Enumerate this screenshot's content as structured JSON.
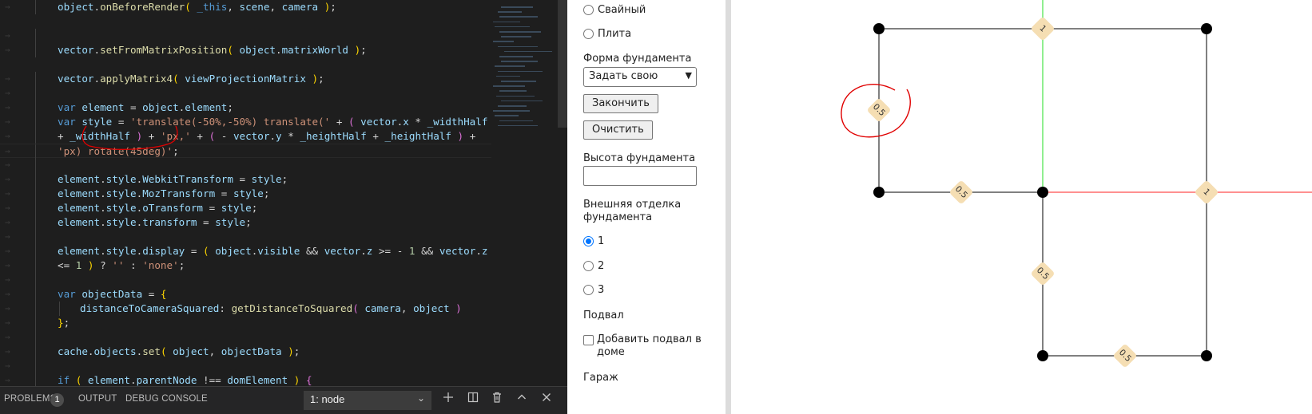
{
  "editor": {
    "lines": [
      {
        "indent": 1,
        "tokens": [
          [
            "v",
            "object"
          ],
          [
            "p",
            "."
          ],
          [
            "f",
            "onBeforeRender"
          ],
          [
            "b",
            "( "
          ],
          [
            "k",
            "_this"
          ],
          [
            "p",
            ", "
          ],
          [
            "v",
            "scene"
          ],
          [
            "p",
            ", "
          ],
          [
            "v",
            "camera"
          ],
          [
            "b",
            " )"
          ],
          [
            "p",
            ";"
          ]
        ]
      },
      {
        "indent": 1,
        "tokens": []
      },
      {
        "indent": 1,
        "tokens": [
          [
            "v",
            "vector"
          ],
          [
            "p",
            "."
          ],
          [
            "f",
            "setFromMatrixPosition"
          ],
          [
            "b",
            "( "
          ],
          [
            "v",
            "object"
          ],
          [
            "p",
            "."
          ],
          [
            "v",
            "matrixWorld"
          ],
          [
            "b",
            " )"
          ],
          [
            "p",
            ";"
          ]
        ]
      },
      {
        "indent": 1,
        "tokens": [
          [
            "v",
            "vector"
          ],
          [
            "p",
            "."
          ],
          [
            "f",
            "applyMatrix4"
          ],
          [
            "b",
            "( "
          ],
          [
            "v",
            "viewProjectionMatrix"
          ],
          [
            "b",
            " )"
          ],
          [
            "p",
            ";"
          ]
        ]
      },
      {
        "indent": 1,
        "tokens": []
      },
      {
        "indent": 1,
        "tokens": [
          [
            "k",
            "var "
          ],
          [
            "v",
            "element"
          ],
          [
            "p",
            " = "
          ],
          [
            "v",
            "object"
          ],
          [
            "p",
            "."
          ],
          [
            "v",
            "element"
          ],
          [
            "p",
            ";"
          ]
        ]
      },
      {
        "indent": 1,
        "tokens": [
          [
            "k",
            "var "
          ],
          [
            "v",
            "style"
          ],
          [
            "p",
            " = "
          ],
          [
            "s",
            "'translate(-50%,-50%) translate('"
          ],
          [
            "p",
            " + "
          ],
          [
            "b2",
            "( "
          ],
          [
            "v",
            "vector"
          ],
          [
            "p",
            "."
          ],
          [
            "v",
            "x"
          ],
          [
            "p",
            " * "
          ],
          [
            "v",
            "_widthHalf"
          ]
        ]
      },
      {
        "indent": 1,
        "tokens": [
          [
            "p",
            "+ "
          ],
          [
            "v",
            "_widthHalf"
          ],
          [
            "b2",
            " )"
          ],
          [
            "p",
            " + "
          ],
          [
            "s",
            "'px,'"
          ],
          [
            "p",
            " + "
          ],
          [
            "b2",
            "( "
          ],
          [
            "p",
            "- "
          ],
          [
            "v",
            "vector"
          ],
          [
            "p",
            "."
          ],
          [
            "v",
            "y"
          ],
          [
            "p",
            " * "
          ],
          [
            "v",
            "_heightHalf"
          ],
          [
            "p",
            " + "
          ],
          [
            "v",
            "_heightHalf"
          ],
          [
            "b2",
            " )"
          ],
          [
            "p",
            " +"
          ]
        ]
      },
      {
        "indent": 1,
        "tokens": [
          [
            "s",
            "'px) rotate(45deg)'"
          ],
          [
            "p",
            ";"
          ]
        ]
      },
      {
        "indent": 1,
        "tokens": []
      },
      {
        "indent": 1,
        "tokens": [
          [
            "v",
            "element"
          ],
          [
            "p",
            "."
          ],
          [
            "v",
            "style"
          ],
          [
            "p",
            "."
          ],
          [
            "v",
            "WebkitTransform"
          ],
          [
            "p",
            " = "
          ],
          [
            "v",
            "style"
          ],
          [
            "p",
            ";"
          ]
        ]
      },
      {
        "indent": 1,
        "tokens": [
          [
            "v",
            "element"
          ],
          [
            "p",
            "."
          ],
          [
            "v",
            "style"
          ],
          [
            "p",
            "."
          ],
          [
            "v",
            "MozTransform"
          ],
          [
            "p",
            " = "
          ],
          [
            "v",
            "style"
          ],
          [
            "p",
            ";"
          ]
        ]
      },
      {
        "indent": 1,
        "tokens": [
          [
            "v",
            "element"
          ],
          [
            "p",
            "."
          ],
          [
            "v",
            "style"
          ],
          [
            "p",
            "."
          ],
          [
            "v",
            "oTransform"
          ],
          [
            "p",
            " = "
          ],
          [
            "v",
            "style"
          ],
          [
            "p",
            ";"
          ]
        ]
      },
      {
        "indent": 1,
        "tokens": [
          [
            "v",
            "element"
          ],
          [
            "p",
            "."
          ],
          [
            "v",
            "style"
          ],
          [
            "p",
            "."
          ],
          [
            "v",
            "transform"
          ],
          [
            "p",
            " = "
          ],
          [
            "v",
            "style"
          ],
          [
            "p",
            ";"
          ]
        ]
      },
      {
        "indent": 1,
        "tokens": []
      },
      {
        "indent": 1,
        "tokens": [
          [
            "v",
            "element"
          ],
          [
            "p",
            "."
          ],
          [
            "v",
            "style"
          ],
          [
            "p",
            "."
          ],
          [
            "v",
            "display"
          ],
          [
            "p",
            " = "
          ],
          [
            "b",
            "( "
          ],
          [
            "v",
            "object"
          ],
          [
            "p",
            "."
          ],
          [
            "v",
            "visible"
          ],
          [
            "p",
            " && "
          ],
          [
            "v",
            "vector"
          ],
          [
            "p",
            "."
          ],
          [
            "v",
            "z"
          ],
          [
            "p",
            " >= - "
          ],
          [
            "n",
            "1"
          ],
          [
            "p",
            " && "
          ],
          [
            "v",
            "vector"
          ],
          [
            "p",
            "."
          ],
          [
            "v",
            "z"
          ]
        ]
      },
      {
        "indent": 1,
        "tokens": [
          [
            "p",
            "<= "
          ],
          [
            "n",
            "1"
          ],
          [
            "b",
            " )"
          ],
          [
            "p",
            " ? "
          ],
          [
            "s",
            "''"
          ],
          [
            "p",
            " : "
          ],
          [
            "s",
            "'none'"
          ],
          [
            "p",
            ";"
          ]
        ]
      },
      {
        "indent": 1,
        "tokens": []
      },
      {
        "indent": 1,
        "tokens": [
          [
            "k",
            "var "
          ],
          [
            "v",
            "objectData"
          ],
          [
            "p",
            " = "
          ],
          [
            "b",
            "{"
          ]
        ]
      },
      {
        "indent": 2,
        "tokens": [
          [
            "v",
            "distanceToCameraSquared"
          ],
          [
            "p",
            ": "
          ],
          [
            "f",
            "getDistanceToSquared"
          ],
          [
            "b2",
            "( "
          ],
          [
            "v",
            "camera"
          ],
          [
            "p",
            ", "
          ],
          [
            "v",
            "object"
          ],
          [
            "b2",
            " )"
          ]
        ]
      },
      {
        "indent": 1,
        "tokens": [
          [
            "b",
            "}"
          ],
          [
            "p",
            ";"
          ]
        ]
      },
      {
        "indent": 1,
        "tokens": []
      },
      {
        "indent": 1,
        "tokens": [
          [
            "v",
            "cache"
          ],
          [
            "p",
            "."
          ],
          [
            "v",
            "objects"
          ],
          [
            "p",
            "."
          ],
          [
            "f",
            "set"
          ],
          [
            "b",
            "( "
          ],
          [
            "v",
            "object"
          ],
          [
            "p",
            ", "
          ],
          [
            "v",
            "objectData"
          ],
          [
            "b",
            " )"
          ],
          [
            "p",
            ";"
          ]
        ]
      },
      {
        "indent": 1,
        "tokens": []
      },
      {
        "indent": 1,
        "tokens": [
          [
            "k",
            "if "
          ],
          [
            "b",
            "( "
          ],
          [
            "v",
            "element"
          ],
          [
            "p",
            "."
          ],
          [
            "v",
            "parentNode"
          ],
          [
            "p",
            " !== "
          ],
          [
            "v",
            "domElement"
          ],
          [
            "b",
            " )"
          ],
          [
            "p",
            " "
          ],
          [
            "b2",
            "{"
          ]
        ]
      }
    ]
  },
  "panel": {
    "problems": "PROBLEMS",
    "problems_count": "1",
    "output": "OUTPUT",
    "debug": "DEBUG CONSOLE",
    "terminal": "1: node",
    "icons": [
      "plus-icon",
      "split-icon",
      "trash-icon",
      "chevron-up-icon",
      "close-icon"
    ]
  },
  "form": {
    "type_options": [
      {
        "label": "Свайный",
        "checked": false
      },
      {
        "label": "Плита",
        "checked": false
      }
    ],
    "shape_label": "Форма фундамента",
    "shape_value": "Задать свою",
    "finish_button": "Закончить",
    "clear_button": "Очистить",
    "height_label": "Высота фундамента",
    "height_value": "",
    "finish_label": "Внешняя отделка фундамента",
    "finish_options": [
      {
        "label": "1",
        "checked": true
      },
      {
        "label": "2",
        "checked": false
      },
      {
        "label": "3",
        "checked": false
      }
    ],
    "basement_label": "Подвал",
    "basement_check": "Добавить подвал в доме",
    "basement_checked": false,
    "garage_label": "Гараж"
  },
  "canvas": {
    "dimension_labels": [
      "1",
      "0.5",
      "0.5",
      "1",
      "0.5",
      "0.5"
    ],
    "axis_colors": {
      "x": "#ff0000",
      "y": "#00e000"
    },
    "annotation_color": "#e00000"
  }
}
